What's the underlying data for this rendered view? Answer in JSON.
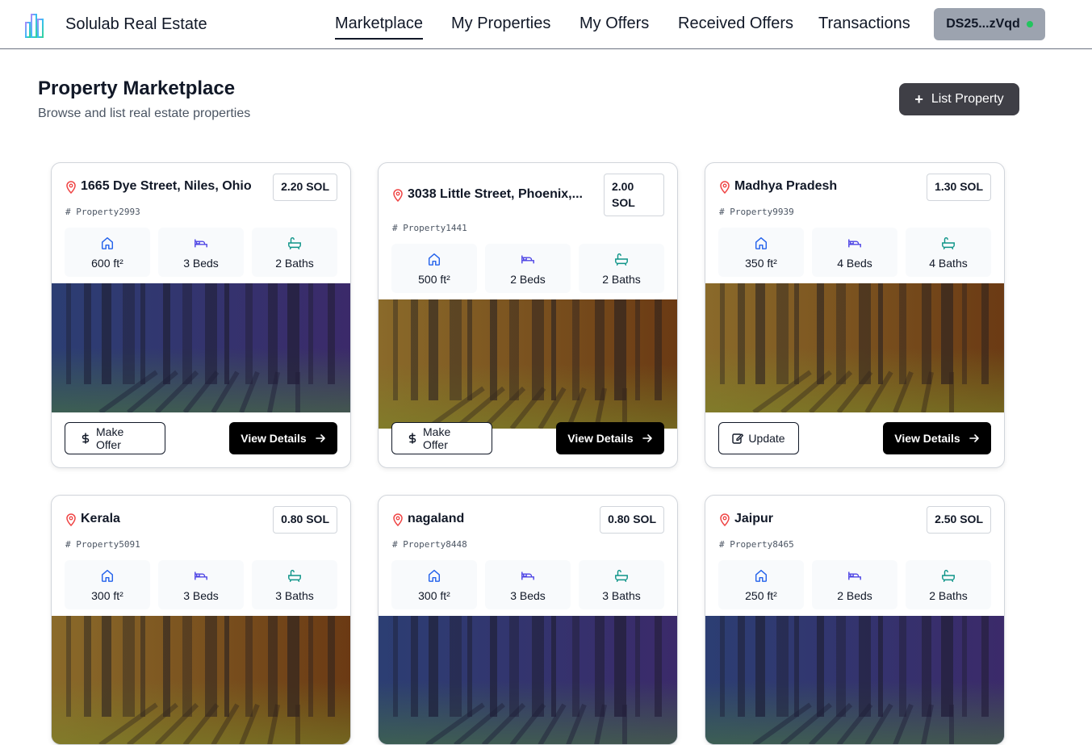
{
  "app": {
    "brand": "Solulab Real Estate"
  },
  "nav": {
    "items": [
      {
        "label": "Marketplace",
        "active": true
      },
      {
        "label": "My Properties",
        "active": false
      },
      {
        "label": "My Offers",
        "active": false
      },
      {
        "label": "Received Offers",
        "active": false
      },
      {
        "label": "Transactions",
        "active": false
      }
    ],
    "wallet": "DS25...zVqd"
  },
  "page": {
    "title": "Property Marketplace",
    "subtitle": "Browse and list real estate properties",
    "list_button": "List Property"
  },
  "cards": [
    {
      "location": "1665 Dye Street, Niles, Ohio",
      "price": "2.20 SOL",
      "id": "Property2993",
      "area": "600 ft²",
      "beds": "3 Beds",
      "baths": "2 Baths",
      "tint": "purple",
      "primary_action": "Make Offer",
      "secondary_action": "View Details"
    },
    {
      "location": "3038 Little Street, Phoenix,...",
      "price": "2.00 SOL",
      "id": "Property1441",
      "area": "500 ft²",
      "beds": "2 Beds",
      "baths": "2 Baths",
      "tint": "orange",
      "primary_action": "Make Offer",
      "secondary_action": "View Details"
    },
    {
      "location": "Madhya Pradesh",
      "price": "1.30 SOL",
      "id": "Property9939",
      "area": "350 ft²",
      "beds": "4 Beds",
      "baths": "4 Baths",
      "tint": "orange",
      "primary_action": "Update",
      "secondary_action": "View Details"
    },
    {
      "location": "Kerala",
      "price": "0.80 SOL",
      "id": "Property5091",
      "area": "300 ft²",
      "beds": "3 Beds",
      "baths": "3 Baths",
      "tint": "orange",
      "primary_action": "",
      "secondary_action": ""
    },
    {
      "location": "nagaland",
      "price": "0.80 SOL",
      "id": "Property8448",
      "area": "300 ft²",
      "beds": "3 Beds",
      "baths": "3 Baths",
      "tint": "purple",
      "primary_action": "",
      "secondary_action": ""
    },
    {
      "location": "Jaipur",
      "price": "2.50 SOL",
      "id": "Property8465",
      "area": "250 ft²",
      "beds": "2 Beds",
      "baths": "2 Baths",
      "tint": "purple",
      "primary_action": "",
      "secondary_action": ""
    }
  ],
  "colors": {
    "accent": "#111827",
    "icon_blue": "#2563eb",
    "icon_indigo": "#4f46e5",
    "icon_teal": "#0d9488",
    "pin_red": "#ef4444",
    "wallet_dot": "#22c55e"
  }
}
